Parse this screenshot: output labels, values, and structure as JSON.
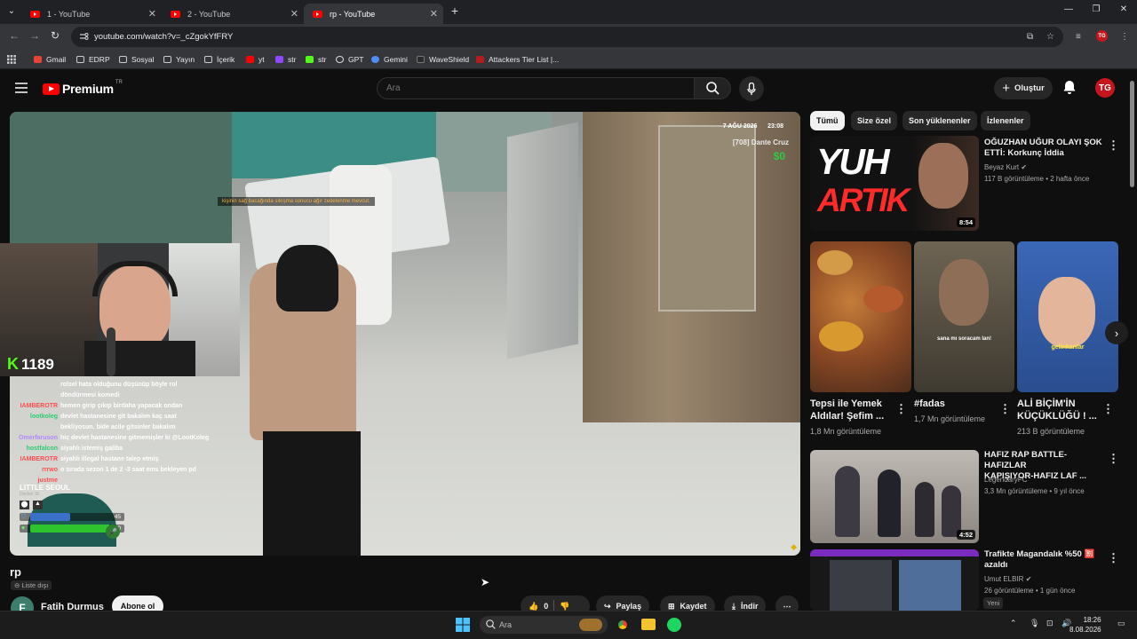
{
  "browser": {
    "tabs": [
      {
        "title": "1 - YouTube",
        "active": false
      },
      {
        "title": "2 - YouTube",
        "active": false
      },
      {
        "title": "rp - YouTube",
        "active": true
      }
    ],
    "url": "youtube.com/watch?v=_cZgokYfFRY",
    "bookmarks": [
      "Gmail",
      "EDRP",
      "Sosyal",
      "Yayın",
      "İçerik",
      "yt",
      "str",
      "str",
      "GPT",
      "Gemini",
      "WaveShield",
      "Attackers Tier List |..."
    ]
  },
  "header": {
    "logo": "Premium",
    "logo_region": "TR",
    "search_placeholder": "Ara",
    "create_label": "Oluştur"
  },
  "video": {
    "hud_date": "7 AĞU 2026",
    "hud_time": "23:08",
    "hud_name": "[708] Dante Cruz",
    "hud_money": "$0",
    "hint": "kişinin sağ bacağında sıkışma sonucu ağır zedelenme mevcut.",
    "viewer_count": "1189",
    "chat": [
      {
        "user": "",
        "msg": "rolsel hata olduğunu düşünüp böyle rol",
        "color": "#ffffff"
      },
      {
        "user": "",
        "msg": "döndürmesi komedi",
        "color": "#ffffff"
      },
      {
        "user": "IAMBEROTR",
        "msg": "hemen girip çıkıp birdaha yapacak ondan",
        "color": "#ff4d4d"
      },
      {
        "user": "lootkoleg",
        "msg": "devlet hastanesine git bakalım kaç saat",
        "color": "#2ecc71"
      },
      {
        "user": "",
        "msg": "bekliyosun. bide acile gitsinler bakalım",
        "color": "#ffffff"
      },
      {
        "user": "Omerfaruson",
        "msg": "hiç devlet hastanesine gitmemişler ki @LootKoleg",
        "color": "#b388ff"
      },
      {
        "user": "hostfalcon",
        "msg": "siyahlı istemiş galiba",
        "color": "#2ecc71"
      },
      {
        "user": "IAMBEROTR",
        "msg": "siyahlı illegal hastane talep etmiş",
        "color": "#ff4d4d"
      },
      {
        "user": "rrrwo",
        "msg": "o sırada sezon 1 de 2 -3 saat ems bekleyen pd",
        "color": "#ff4d4d"
      },
      {
        "user": "justme",
        "msg": "",
        "color": "#ff4d4d"
      }
    ],
    "location": "LITTLE SEOUL",
    "location_sub": "Decker St",
    "armor_value": "45",
    "armor_fraction": 0.45,
    "health_value": "90",
    "health_fraction": 0.9,
    "title": "rp",
    "visibility": "Liste dışı"
  },
  "channel": {
    "initial": "F",
    "name": "Fatih Durmus",
    "subscribe_label": "Abone ol"
  },
  "actions": {
    "like_count": "0",
    "share_label": "Paylaş",
    "save_label": "Kaydet",
    "download_label": "İndir"
  },
  "chips": [
    "Tümü",
    "Size özel",
    "Son yüklenenler",
    "İzlenenler"
  ],
  "recs": [
    {
      "title": "OĞUZHAN UĞUR OLAYI ŞOK ETTİ: Korkunç İddia",
      "title_lines": [
        "OĞUZHAN UĞUR OLAYI ŞOK",
        "ETTİ: Korkunç İddia"
      ],
      "channel": "Beyaz Kurt",
      "meta": "117 B görüntüleme • 2 hafta önce",
      "duration": "8:54",
      "thumb_text": [
        "YUH",
        "ARTIK"
      ]
    },
    {
      "title_lines": [
        "HAFIZ RAP BATTLE-HAFIZLAR",
        "KAPIŞIYOR-HAFIZ LAF ..."
      ],
      "channel": "LegendaryFC",
      "meta": "3,3 Mn görüntüleme • 9 yıl önce",
      "duration": "4:52"
    },
    {
      "title_lines": [
        "Trafikte Magandalık %50 🈹",
        "azaldı"
      ],
      "channel": "Umut ELBIR",
      "meta": "26 görüntüleme • 1 gün önce",
      "badge": "Yeni"
    }
  ],
  "shorts": [
    {
      "title_lines": [
        "Tepsi ile Yemek",
        "Aldılar! Şefim ..."
      ],
      "views": "1,8 Mn görüntüleme"
    },
    {
      "title_lines": [
        "#fadas"
      ],
      "views": "1,7 Mn görüntüleme",
      "caption": "sana mı soracam lan!"
    },
    {
      "title_lines": [
        "ALİ BİÇİM'İN",
        "KÜÇÜKLÜĞÜ ! ..."
      ],
      "views": "213 B görüntüleme",
      "caption": "gelinkanlar"
    }
  ],
  "taskbar": {
    "search_placeholder": "Ara",
    "time": "18:26",
    "date": "8.08.2026"
  },
  "colors": {
    "brand": "#ff0000",
    "background": "#0f0f0f",
    "kick_green": "#53fc18",
    "money_green": "#2ecc40"
  }
}
